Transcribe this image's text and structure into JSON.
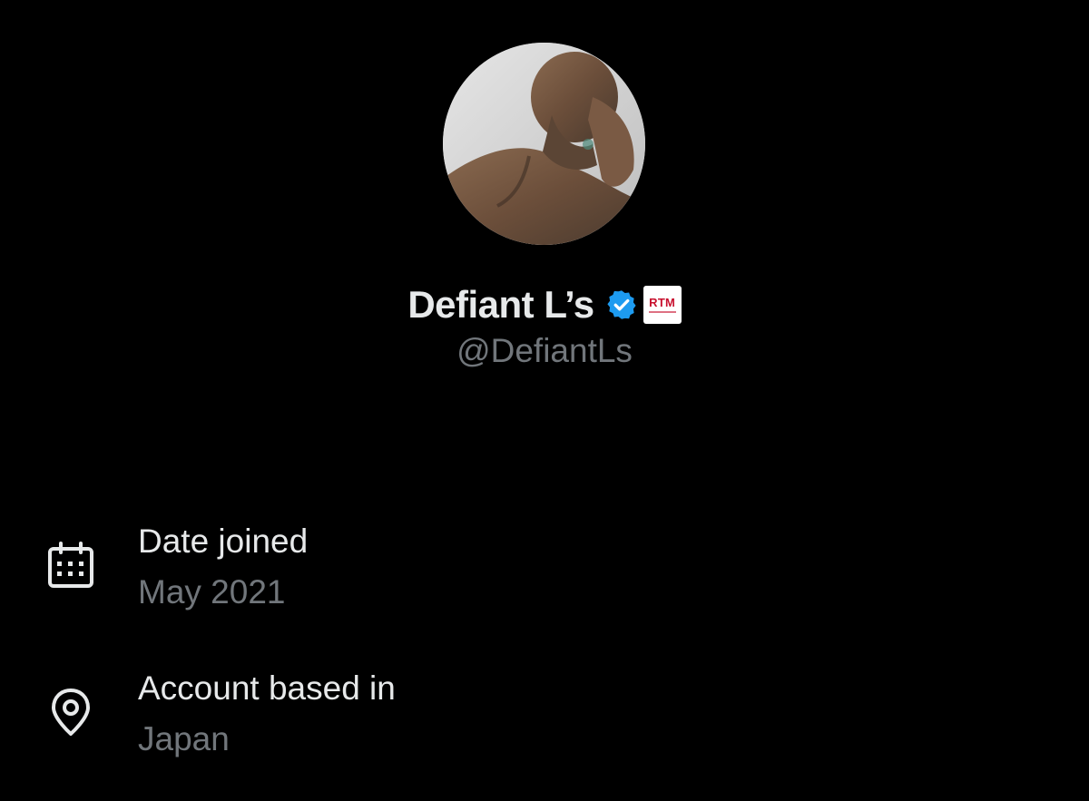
{
  "profile": {
    "display_name": "Defiant L’s",
    "handle": "@DefiantLs",
    "verified": true,
    "affiliation_badge": "RTM",
    "avatar_alt": "profile-photo"
  },
  "about": {
    "joined": {
      "label": "Date joined",
      "value": "May 2021",
      "icon": "calendar-icon"
    },
    "location": {
      "label": "Account based in",
      "value": "Japan",
      "icon": "location-pin-icon"
    }
  },
  "colors": {
    "background": "#000000",
    "primary_text": "#e7e9ea",
    "secondary_text": "#71767b",
    "verified_blue": "#1d9bf0",
    "badge_red": "#c8102e"
  }
}
